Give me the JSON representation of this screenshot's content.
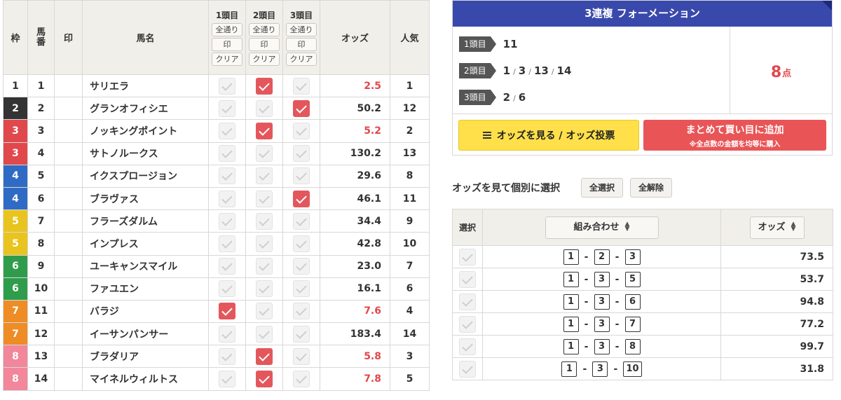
{
  "table": {
    "headers": {
      "waku": "枠",
      "umaban": "馬番",
      "mark": "印",
      "name": "馬名",
      "odds": "オッズ",
      "pop": "人気"
    },
    "legs": [
      {
        "label": "1頭目",
        "all": "全通り",
        "mark": "印",
        "clear": "クリア"
      },
      {
        "label": "2頭目",
        "all": "全通り",
        "mark": "印",
        "clear": "クリア"
      },
      {
        "label": "3頭目",
        "all": "全通り",
        "mark": "印",
        "clear": "クリア"
      }
    ],
    "waku_colors": {
      "1": "#ffffff",
      "2": "#333333",
      "3": "#e0484c",
      "4": "#2f6bc4",
      "5": "#e9c41e",
      "6": "#2f9c4c",
      "7": "#ee8c26",
      "8": "#f2869a"
    },
    "rows": [
      {
        "waku": "1",
        "uma": "1",
        "name": "サリエラ",
        "odds": "2.5",
        "hot": true,
        "pop": "1",
        "c": [
          false,
          true,
          false
        ]
      },
      {
        "waku": "2",
        "uma": "2",
        "name": "グランオフィシエ",
        "odds": "50.2",
        "hot": false,
        "pop": "12",
        "c": [
          false,
          false,
          true
        ]
      },
      {
        "waku": "3",
        "uma": "3",
        "name": "ノッキングポイント",
        "odds": "5.2",
        "hot": true,
        "pop": "2",
        "c": [
          false,
          true,
          false
        ]
      },
      {
        "waku": "3",
        "uma": "4",
        "name": "サトノルークス",
        "odds": "130.2",
        "hot": false,
        "pop": "13",
        "c": [
          false,
          false,
          false
        ]
      },
      {
        "waku": "4",
        "uma": "5",
        "name": "イクスプロージョン",
        "odds": "29.6",
        "hot": false,
        "pop": "8",
        "c": [
          false,
          false,
          false
        ]
      },
      {
        "waku": "4",
        "uma": "6",
        "name": "ブラヴァス",
        "odds": "46.1",
        "hot": false,
        "pop": "11",
        "c": [
          false,
          false,
          true
        ]
      },
      {
        "waku": "5",
        "uma": "7",
        "name": "フラーズダルム",
        "odds": "34.4",
        "hot": false,
        "pop": "9",
        "c": [
          false,
          false,
          false
        ]
      },
      {
        "waku": "5",
        "uma": "8",
        "name": "インプレス",
        "odds": "42.8",
        "hot": false,
        "pop": "10",
        "c": [
          false,
          false,
          false
        ]
      },
      {
        "waku": "6",
        "uma": "9",
        "name": "ユーキャンスマイル",
        "odds": "23.0",
        "hot": false,
        "pop": "7",
        "c": [
          false,
          false,
          false
        ]
      },
      {
        "waku": "6",
        "uma": "10",
        "name": "ファユエン",
        "odds": "16.1",
        "hot": false,
        "pop": "6",
        "c": [
          false,
          false,
          false
        ]
      },
      {
        "waku": "7",
        "uma": "11",
        "name": "バラジ",
        "odds": "7.6",
        "hot": true,
        "pop": "4",
        "c": [
          true,
          false,
          false
        ]
      },
      {
        "waku": "7",
        "uma": "12",
        "name": "イーサンパンサー",
        "odds": "183.4",
        "hot": false,
        "pop": "14",
        "c": [
          false,
          false,
          false
        ]
      },
      {
        "waku": "8",
        "uma": "13",
        "name": "ブラダリア",
        "odds": "5.8",
        "hot": true,
        "pop": "3",
        "c": [
          false,
          true,
          false
        ]
      },
      {
        "waku": "8",
        "uma": "14",
        "name": "マイネルウィルトス",
        "odds": "7.8",
        "hot": true,
        "pop": "5",
        "c": [
          false,
          true,
          false
        ]
      }
    ]
  },
  "formation": {
    "title": "3連複 フォーメーション",
    "legs": [
      {
        "label": "1頭目",
        "values": [
          "11"
        ]
      },
      {
        "label": "2頭目",
        "values": [
          "1",
          "3",
          "13",
          "14"
        ]
      },
      {
        "label": "3頭目",
        "values": [
          "2",
          "6"
        ]
      }
    ],
    "separator": "/",
    "points": "8",
    "points_unit": "点",
    "odds_button": "オッズを見る / オッズ投票",
    "add_button_line1": "まとめて買い目に追加",
    "add_button_line2": "※全点数の金額を均等に購入"
  },
  "individual": {
    "title": "オッズを見て個別に選択",
    "select_all": "全選択",
    "deselect_all": "全解除",
    "headers": {
      "select": "選択",
      "combo": "組み合わせ",
      "odds": "オッズ"
    },
    "rows": [
      {
        "combo": [
          "1",
          "2",
          "3"
        ],
        "odds": "73.5"
      },
      {
        "combo": [
          "1",
          "3",
          "5"
        ],
        "odds": "53.7"
      },
      {
        "combo": [
          "1",
          "3",
          "6"
        ],
        "odds": "94.8"
      },
      {
        "combo": [
          "1",
          "3",
          "7"
        ],
        "odds": "77.2"
      },
      {
        "combo": [
          "1",
          "3",
          "8"
        ],
        "odds": "99.7"
      },
      {
        "combo": [
          "1",
          "3",
          "10"
        ],
        "odds": "31.8"
      }
    ]
  },
  "colors": {
    "accent_blue": "#3949ab",
    "checked_red": "#e3575c",
    "hot_odds": "#e0484c",
    "odds_button_yellow": "#ffe04a",
    "add_button_red": "#e95557",
    "header_bg": "#f1efe9"
  }
}
